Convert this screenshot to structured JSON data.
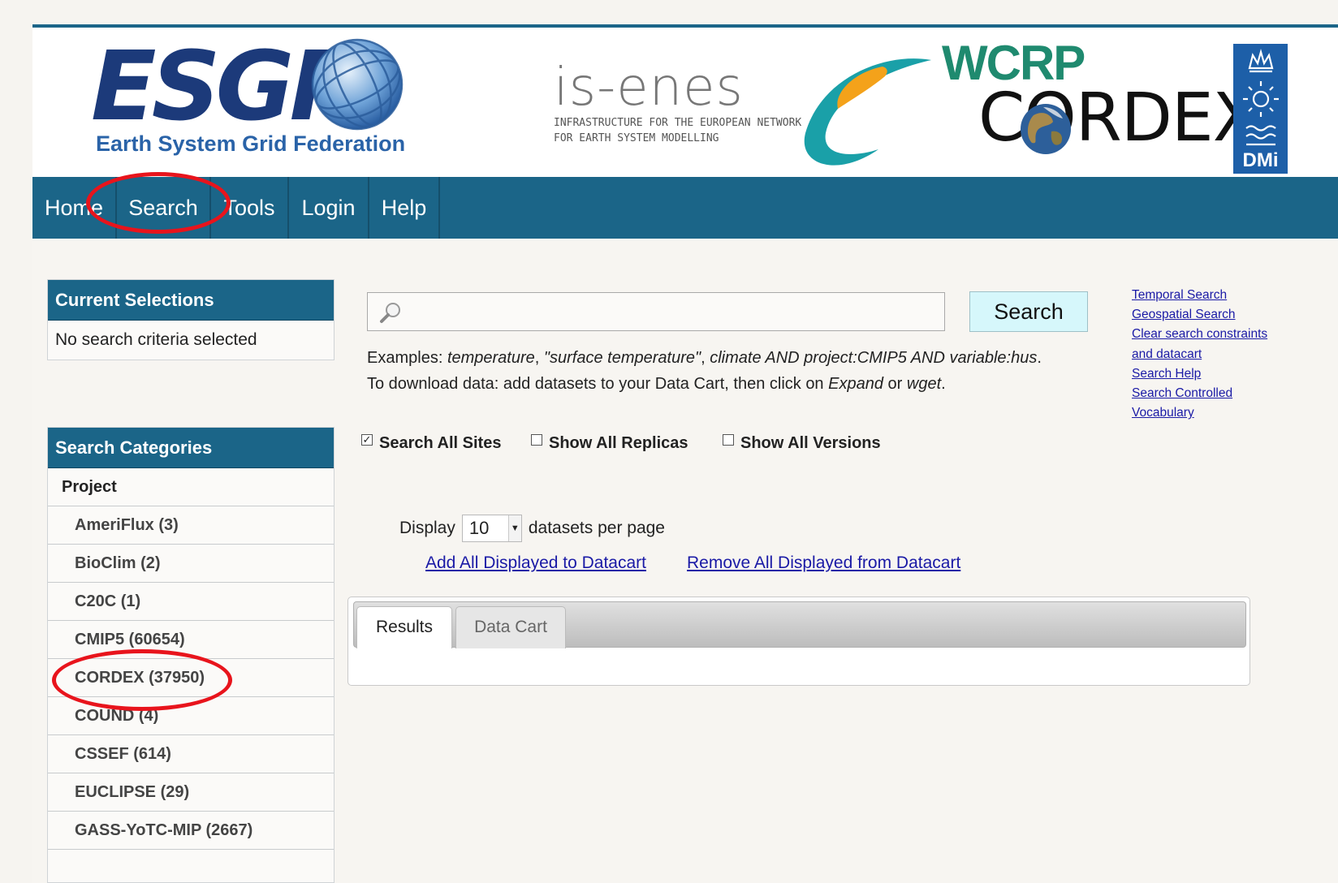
{
  "header": {
    "esgf_title": "ESGF",
    "esgf_subtitle": "Earth System Grid Federation",
    "isenes_title": "is-enes",
    "isenes_subtitle": "INFRASTRUCTURE FOR THE EUROPEAN NETWORK\nFOR EARTH SYSTEM MODELLING",
    "wcrp": "WCRP",
    "cordex": "CORDEX",
    "dmi": "DMi"
  },
  "nav": {
    "items": [
      {
        "label": "Home"
      },
      {
        "label": "Search"
      },
      {
        "label": "Tools"
      },
      {
        "label": "Login"
      },
      {
        "label": "Help"
      }
    ]
  },
  "current_selections": {
    "title": "Current Selections",
    "empty_text": "No search criteria selected"
  },
  "categories": {
    "title": "Search Categories",
    "group": "Project",
    "items": [
      {
        "label": "AmeriFlux (3)"
      },
      {
        "label": "BioClim (2)"
      },
      {
        "label": "C20C (1)"
      },
      {
        "label": "CMIP5 (60654)"
      },
      {
        "label": "CORDEX (37950)"
      },
      {
        "label": "COUND (4)"
      },
      {
        "label": "CSSEF (614)"
      },
      {
        "label": "EUCLIPSE (29)"
      },
      {
        "label": "GASS-YoTC-MIP (2667)"
      }
    ]
  },
  "search": {
    "placeholder": "",
    "value": "",
    "button_label": "Search",
    "examples_prefix": "Examples: ",
    "ex1": "temperature",
    "sep1": ", ",
    "ex2": "\"surface temperature\"",
    "sep2": ", ",
    "ex3": "climate AND project:CMIP5 AND variable:hus",
    "end": ".",
    "download_prefix": "To download data: add datasets to your Data Cart, then click on ",
    "expand": "Expand",
    "or": " or ",
    "wget": "wget",
    "download_end": "."
  },
  "side_links": {
    "temporal": "Temporal Search",
    "geospatial": "Geospatial Search",
    "clear_1": "Clear search constraints",
    "clear_2": "and datacart",
    "help": "Search Help",
    "vocab_1": "Search Controlled",
    "vocab_2": "Vocabulary"
  },
  "options": {
    "all_sites": {
      "label": "Search All Sites",
      "checked": true
    },
    "all_replicas": {
      "label": "Show All Replicas",
      "checked": false
    },
    "all_versions": {
      "label": "Show All Versions",
      "checked": false
    }
  },
  "display": {
    "prefix": "Display",
    "value": "10",
    "suffix": "datasets per page"
  },
  "datacart": {
    "add_all": "Add All Displayed to Datacart",
    "remove_all": "Remove All Displayed from Datacart"
  },
  "tabs": [
    {
      "label": "Results",
      "active": true
    },
    {
      "label": "Data Cart",
      "active": false
    }
  ],
  "colors": {
    "nav_bg": "#1b6588",
    "annotation": "#e8141c",
    "link": "#1a1aa6",
    "search_button_bg": "#d6f7fb"
  }
}
